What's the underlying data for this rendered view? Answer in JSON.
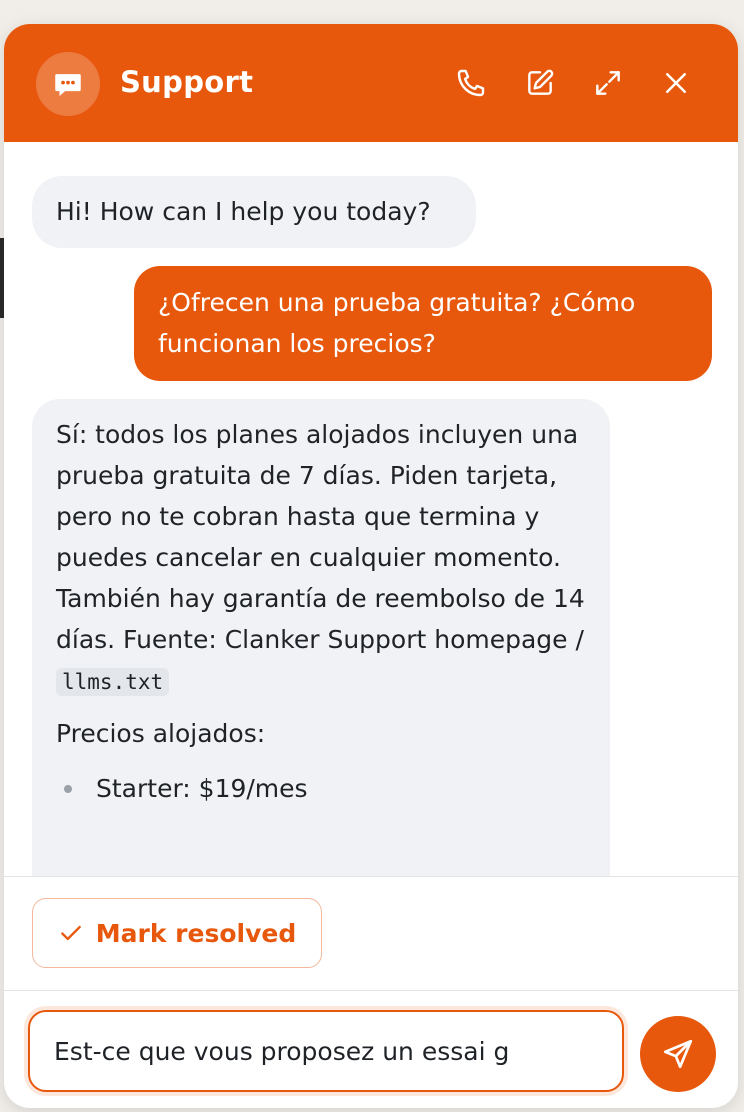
{
  "header": {
    "title": "Support",
    "icons": [
      "chat-bubble-icon",
      "phone-icon",
      "edit-icon",
      "expand-icon",
      "close-icon"
    ]
  },
  "messages": {
    "bot_greeting": "Hi! How can I help you today?",
    "user_question": "¿Ofrecen una prueba gratuita? ¿Cómo funcionan los precios?",
    "bot_answer_text": "Sí: todos los planes alojados incluyen una prueba gratuita de 7 días. Piden tarjeta, pero no te cobran hasta que termina y puedes cancelar en cualquier momento. También hay garantía de reembolso de 14 días. Fuente: Clanker Support homepage /",
    "bot_answer_code": "llms.txt",
    "pricing_heading": "Precios alojados:",
    "pricing_items": [
      "Starter: $19/mes"
    ]
  },
  "actions": {
    "mark_resolved_label": "Mark resolved"
  },
  "composer": {
    "value": "Est-ce que vous proposez un essai g"
  },
  "colors": {
    "accent": "#e8580c",
    "bot_bubble": "#f0f2f5"
  }
}
